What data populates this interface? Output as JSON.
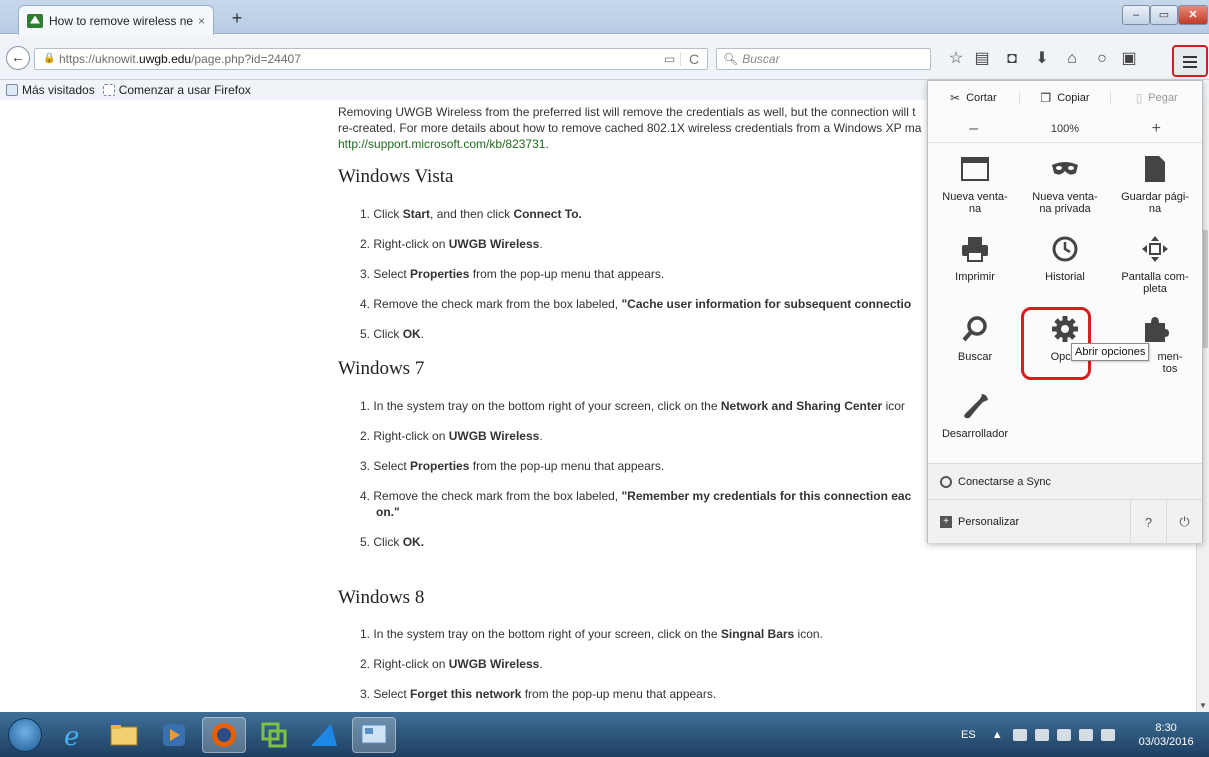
{
  "tab": {
    "title": "How to remove wireless ne...",
    "close": "×",
    "new_tab": "+"
  },
  "window": {
    "minimize": "–",
    "maximize": "▭",
    "close": "✕"
  },
  "nav": {
    "back": "←",
    "url_prefix": "https://uknowit.",
    "url_domain": "uwgb.edu",
    "url_suffix": "/page.php?id=24407",
    "reload": "C",
    "search_placeholder": "Buscar"
  },
  "bookmarks": [
    {
      "label": "Más visitados"
    },
    {
      "label": "Comenzar a usar Firefox"
    }
  ],
  "article": {
    "intro_line1": "Removing UWGB Wireless from the preferred list will remove the credentials as well, but the connection will t",
    "intro_line2": "re-created. For more details about how to remove cached 802.1X wireless credentials from a Windows XP ma",
    "intro_link": "http://support.microsoft.com/kb/823731",
    "intro_link_end": ".",
    "vista": {
      "heading": "Windows Vista",
      "steps": [
        {
          "n": "1.",
          "a": "Click ",
          "b": "Start",
          "c": ", and then click ",
          "d": "Connect To."
        },
        {
          "n": "2.",
          "a": "Right-click on ",
          "b": "UWGB Wireless",
          "c": "."
        },
        {
          "n": "3.",
          "a": "Select ",
          "b": "Properties",
          "c": " from the pop-up menu that appears."
        },
        {
          "n": "4.",
          "a": "Remove the check mark from the box labeled, ",
          "b": "\"Cache user information for subsequent connectio"
        },
        {
          "n": "5.",
          "a": "Click ",
          "b": "OK",
          "c": "."
        }
      ]
    },
    "win7": {
      "heading": "Windows 7",
      "steps": [
        {
          "n": "1.",
          "a": "In the system tray on the bottom right of your screen, click on the ",
          "b": "Network and Sharing Center",
          "c": " icor"
        },
        {
          "n": "2.",
          "a": "Right-click on ",
          "b": "UWGB Wireless",
          "c": "."
        },
        {
          "n": "3.",
          "a": "Select ",
          "b": "Properties",
          "c": " from the pop-up menu that appears."
        },
        {
          "n": "4.",
          "a": "Remove the check mark from the box labeled, ",
          "b": "\"Remember my credentials for this connection eac",
          "b2": "on.\""
        },
        {
          "n": "5.",
          "a": "Click ",
          "b": "OK."
        }
      ]
    },
    "win8": {
      "heading": "Windows 8",
      "steps": [
        {
          "n": "1.",
          "a": "In the system tray on the bottom right of your screen, click on the ",
          "b": "Singnal Bars",
          "c": " icon."
        },
        {
          "n": "2.",
          "a": "Right-click on ",
          "b": "UWGB Wireless",
          "c": "."
        },
        {
          "n": "3.",
          "a": "Select ",
          "b": "Forget this network",
          "c": " from the pop-up menu that appears."
        }
      ]
    }
  },
  "menu": {
    "cut": "Cortar",
    "copy": "Copiar",
    "paste": "Pegar",
    "zoom_out": "–",
    "zoom": "100%",
    "zoom_in": "+",
    "items": [
      {
        "label1": "Nueva venta-",
        "label2": "na",
        "icon": "window-icon"
      },
      {
        "label1": "Nueva venta-",
        "label2": "na privada",
        "icon": "private-mask-icon"
      },
      {
        "label1": "Guardar pági-",
        "label2": "na",
        "icon": "save-page-icon"
      },
      {
        "label1": "Imprimir",
        "label2": "",
        "icon": "printer-icon"
      },
      {
        "label1": "Historial",
        "label2": "",
        "icon": "history-clock-icon"
      },
      {
        "label1": "Pantalla com-",
        "label2": "pleta",
        "icon": "fullscreen-icon"
      },
      {
        "label1": "Buscar",
        "label2": "",
        "icon": "search-icon"
      },
      {
        "label1": "Opcio",
        "label2": "",
        "icon": "gear-icon"
      },
      {
        "label1": "men-",
        "label2": "tos",
        "icon": "puzzle-icon"
      },
      {
        "label1": "Desarrollador",
        "label2": "",
        "icon": "wrench-icon"
      }
    ],
    "tooltip": "Abrir opciones",
    "sync": "Conectarse a Sync",
    "customize": "Personalizar",
    "help": "?",
    "quit": "⏻",
    "highlight_color": "#d81f1f"
  },
  "taskbar": {
    "lang": "ES",
    "time": "8:30",
    "date": "03/03/2016"
  }
}
